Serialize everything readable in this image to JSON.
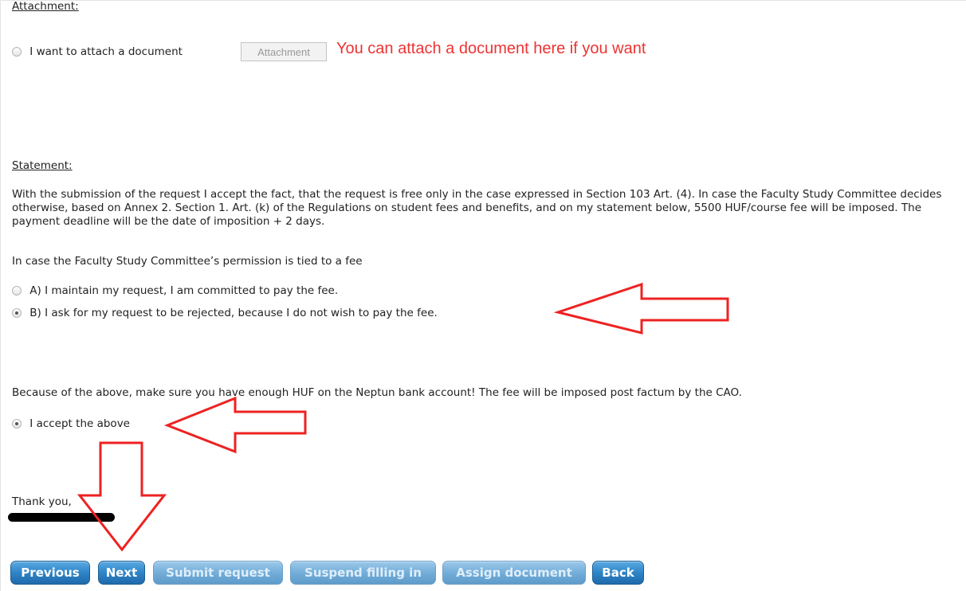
{
  "attachment": {
    "title": "Attachment:",
    "radio_label": "I want to attach a document",
    "radio_checked": false,
    "button_label": "Attachment",
    "hint": "You can attach a document here if you want"
  },
  "statement": {
    "title": "Statement:",
    "paragraph": "With the submission of the request I accept the fact, that the request is free only in the case expressed in Section 103 Art. (4). In case the Faculty Study Committee decides otherwise, based on Annex 2. Section 1. Art. (k) of the Regulations on student fees and benefits, and on my statement below, 5500 HUF/course fee will be imposed. The payment deadline will be the date of imposition + 2 days.",
    "question": "In case the Faculty Study Committee’s permission is tied to a fee",
    "options": [
      {
        "label": "A) I maintain my request, I am committed to pay the fee.",
        "checked": false
      },
      {
        "label": "B) I ask for my request to be rejected, because I do not wish to pay the fee.",
        "checked": true
      }
    ]
  },
  "notice": {
    "text": "Because of the above, make sure you have enough HUF on the Neptun bank account! The fee will be imposed post factum by the CAO.",
    "accept_label": "I accept the above",
    "accept_checked": true
  },
  "closing": {
    "thanks": "Thank you,"
  },
  "buttons": {
    "previous": "Previous",
    "next": "Next",
    "submit": "Submit request",
    "suspend": "Suspend filling in",
    "assign": "Assign document",
    "back": "Back"
  },
  "annotation_color": "#ee2222"
}
